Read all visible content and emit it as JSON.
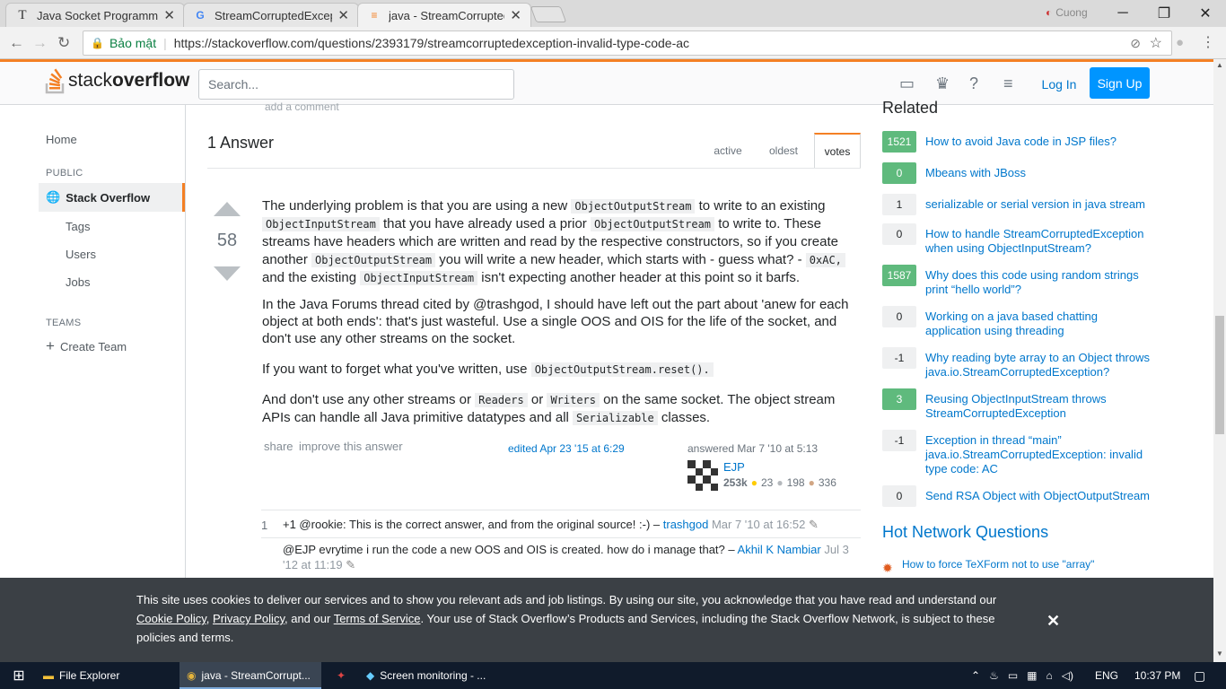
{
  "browser": {
    "tabs": [
      {
        "title": "Java Socket Programming",
        "icon": "T"
      },
      {
        "title": "StreamCorruptedExceptio",
        "icon": "G"
      },
      {
        "title": "java - StreamCorruptedE",
        "icon": "so"
      }
    ],
    "profile": "Cuong",
    "secure_label": "Bảo mật",
    "url": "https://stackoverflow.com/questions/2393179/streamcorruptedexception-invalid-type-code-ac"
  },
  "header": {
    "logo_light": "stack",
    "logo_bold": "overflow",
    "search_placeholder": "Search...",
    "login": "Log In",
    "signup": "Sign Up"
  },
  "leftnav": {
    "home": "Home",
    "public": "PUBLIC",
    "stackoverflow": "Stack Overflow",
    "tags": "Tags",
    "users": "Users",
    "jobs": "Jobs",
    "teams": "TEAMS",
    "create_team": "Create Team"
  },
  "main": {
    "add_comment": "add a comment",
    "answers_header": "1 Answer",
    "sort_tabs": [
      "active",
      "oldest",
      "votes"
    ],
    "vote_count": "58",
    "share": "share",
    "improve": "improve this answer",
    "edited": "edited Apr 23 '15 at 6:29",
    "answered": "answered Mar 7 '10 at 5:13",
    "user": {
      "name": "EJP",
      "rep": "253k",
      "gold": "23",
      "silver": "198",
      "bronze": "336"
    },
    "comments": [
      {
        "score": "1",
        "text": "+1 @rookie: This is the correct answer, and from the original source! :-) –",
        "user": "trashgod",
        "date": "Mar 7 '10 at 16:52"
      },
      {
        "score": "",
        "text": "@EJP evrytime i run the code a new OOS and OIS is created. how do i manage that? –",
        "user": "Akhil K Nambiar",
        "date": "Jul 3 '12 at 11:19"
      }
    ]
  },
  "sidebar": {
    "related_title": "Related",
    "related": [
      {
        "votes": "1521",
        "accepted": true,
        "title": "How to avoid Java code in JSP files?"
      },
      {
        "votes": "0",
        "accepted": true,
        "title": "Mbeans with JBoss"
      },
      {
        "votes": "1",
        "accepted": false,
        "title": "serializable or serial version in java stream"
      },
      {
        "votes": "0",
        "accepted": false,
        "title": "How to handle StreamCorruptedException when using ObjectInputStream?"
      },
      {
        "votes": "1587",
        "accepted": true,
        "title": "Why does this code using random strings print “hello world”?"
      },
      {
        "votes": "0",
        "accepted": false,
        "title": "Working on a java based chatting application using threading"
      },
      {
        "votes": "-1",
        "accepted": false,
        "title": "Why reading byte array to an Object throws java.io.StreamCorruptedException?"
      },
      {
        "votes": "3",
        "accepted": true,
        "title": "Reusing ObjectInputStream throws StreamCorruptedException"
      },
      {
        "votes": "-1",
        "accepted": false,
        "title": "Exception in thread “main” java.io.StreamCorruptedException: invalid type code: AC"
      },
      {
        "votes": "0",
        "accepted": false,
        "title": "Send RSA Object with ObjectOutputStream"
      }
    ],
    "hot_title": "Hot Network Questions",
    "hot_first": "How to force TeXForm not to use \"array\""
  },
  "cookie": {
    "text1": "This site uses cookies to deliver our services and to show you relevant ads and job listings. By using our site, you acknowledge that you have read and understand our",
    "cookie_policy": "Cookie Policy",
    "privacy_policy": "Privacy Policy",
    "and_our": ", and our",
    "terms": "Terms of Service",
    "text2": ". Your use of Stack Overflow’s Products and Services, including the Stack Overflow Network, is subject to these policies and terms."
  },
  "taskbar": {
    "file_explorer": "File Explorer",
    "chrome": "java - StreamCorrupt...",
    "screen": "Screen monitoring - ...",
    "lang": "ENG",
    "time": "10:37 PM"
  }
}
